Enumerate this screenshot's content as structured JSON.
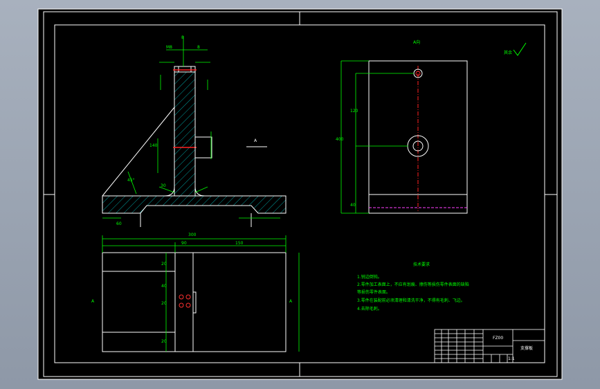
{
  "drawing": {
    "top_label": "A向",
    "roughness_label": "其余",
    "section_marker": "A",
    "left_marker": "A",
    "right_marker": "A",
    "dims": {
      "top_dim_1": "M8",
      "top_dim_2": "8",
      "top_dim_3": "8",
      "overall_width": "300",
      "left_part": "90",
      "right_part": "150",
      "base_left": "60",
      "angle": "45°",
      "web": "30",
      "height_a": "140",
      "height_b": "120",
      "height_c": "40",
      "plate_height": "400",
      "rv_a": "20",
      "rv_b": "40",
      "rv_c": "20",
      "rv_d": "20"
    }
  },
  "tech_req": {
    "title": "技术要求",
    "items": [
      "1.锐边倒钝。",
      "2.零件加工表面上，不应有划痕、擦伤等损伤零件表面的缺陷",
      "等损伤零件表面。",
      "3.零件在装配前必须清理和清洗干净，不得有毛刺、飞边。",
      "4.去除毛刺。"
    ]
  },
  "title_block": {
    "part_name": "支撑板",
    "code": "FZ00",
    "scale": "1:1"
  }
}
